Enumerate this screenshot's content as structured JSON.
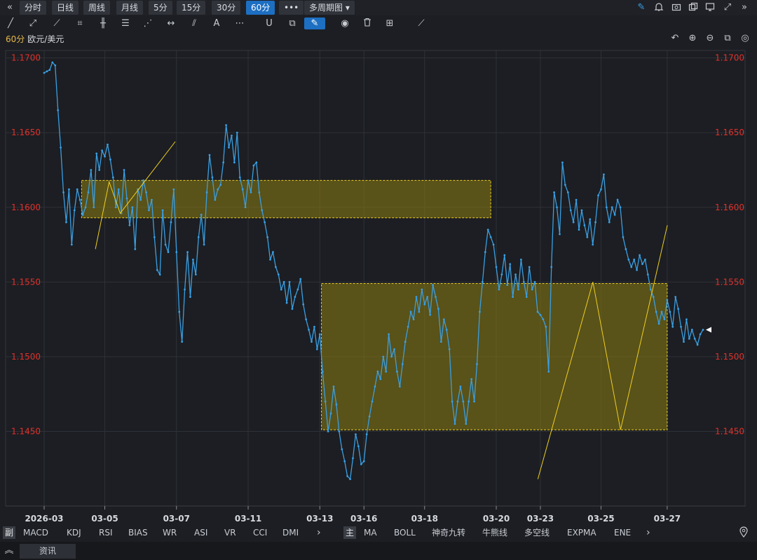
{
  "toolbar": {
    "periods": [
      "分时",
      "日线",
      "周线",
      "月线",
      "5分",
      "15分",
      "30分",
      "60分"
    ],
    "active_period": "60分",
    "more": "•••",
    "multi_period": "多周期图 ▾"
  },
  "chart_header": {
    "period": "60分",
    "symbol": "欧元/美元"
  },
  "indicator_tabs": {
    "sub_label": "副",
    "sub": [
      "MACD",
      "KDJ",
      "RSI",
      "BIAS",
      "WR",
      "ASI",
      "VR",
      "CCI",
      "DMI"
    ],
    "main_label": "主",
    "main": [
      "MA",
      "BOLL",
      "神奇九转",
      "牛熊线",
      "多空线",
      "EXPMA",
      "ENE"
    ],
    "arrow": "›"
  },
  "footer": {
    "news": "资讯"
  },
  "colors": {
    "price_line": "#3a9fe3",
    "axis_price": "#e0302a",
    "drawing": "#f0d020",
    "rect_fill": "#8c7d12"
  },
  "chart_data": {
    "type": "line",
    "symbol": "欧元/美元",
    "period": "60分",
    "ylim": [
      1.14,
      1.1705
    ],
    "yticks": [
      "1.1700",
      "1.1650",
      "1.1600",
      "1.1550",
      "1.1500",
      "1.1450"
    ],
    "xticks": [
      {
        "i": 0,
        "label": "2026-03"
      },
      {
        "i": 22,
        "label": "03-05"
      },
      {
        "i": 48,
        "label": "03-07"
      },
      {
        "i": 74,
        "label": "03-11"
      },
      {
        "i": 100,
        "label": "03-13"
      },
      {
        "i": 116,
        "label": "03-16"
      },
      {
        "i": 138,
        "label": "03-18"
      },
      {
        "i": 164,
        "label": "03-20"
      },
      {
        "i": 180,
        "label": "03-23"
      },
      {
        "i": 202,
        "label": "03-25"
      },
      {
        "i": 226,
        "label": "03-27"
      }
    ],
    "points": 240,
    "anchors": [
      [
        0,
        1.169
      ],
      [
        2,
        1.1692
      ],
      [
        3,
        1.1697
      ],
      [
        4,
        1.1695
      ],
      [
        5,
        1.1665
      ],
      [
        6,
        1.164
      ],
      [
        7,
        1.161
      ],
      [
        8,
        1.159
      ],
      [
        9,
        1.1612
      ],
      [
        10,
        1.1575
      ],
      [
        11,
        1.1598
      ],
      [
        12,
        1.1612
      ],
      [
        13,
        1.1605
      ],
      [
        14,
        1.1595
      ],
      [
        15,
        1.16
      ],
      [
        16,
        1.161
      ],
      [
        17,
        1.1625
      ],
      [
        18,
        1.16
      ],
      [
        19,
        1.1636
      ],
      [
        20,
        1.1625
      ],
      [
        21,
        1.1638
      ],
      [
        22,
        1.1634
      ],
      [
        23,
        1.1642
      ],
      [
        24,
        1.1632
      ],
      [
        25,
        1.162
      ],
      [
        26,
        1.16
      ],
      [
        27,
        1.1612
      ],
      [
        28,
        1.1596
      ],
      [
        29,
        1.1625
      ],
      [
        30,
        1.1606
      ],
      [
        31,
        1.1588
      ],
      [
        32,
        1.16
      ],
      [
        33,
        1.1572
      ],
      [
        34,
        1.1612
      ],
      [
        35,
        1.1605
      ],
      [
        36,
        1.1618
      ],
      [
        37,
        1.161
      ],
      [
        38,
        1.1598
      ],
      [
        39,
        1.1605
      ],
      [
        40,
        1.158
      ],
      [
        41,
        1.1558
      ],
      [
        42,
        1.1555
      ],
      [
        43,
        1.1598
      ],
      [
        44,
        1.1575
      ],
      [
        45,
        1.157
      ],
      [
        46,
        1.159
      ],
      [
        47,
        1.1612
      ],
      [
        48,
        1.157
      ],
      [
        49,
        1.153
      ],
      [
        50,
        1.151
      ],
      [
        51,
        1.1545
      ],
      [
        52,
        1.157
      ],
      [
        53,
        1.154
      ],
      [
        54,
        1.1565
      ],
      [
        55,
        1.1555
      ],
      [
        56,
        1.158
      ],
      [
        57,
        1.1595
      ],
      [
        58,
        1.1575
      ],
      [
        59,
        1.161
      ],
      [
        60,
        1.1635
      ],
      [
        61,
        1.162
      ],
      [
        62,
        1.1605
      ],
      [
        63,
        1.1612
      ],
      [
        64,
        1.1615
      ],
      [
        65,
        1.163
      ],
      [
        66,
        1.1655
      ],
      [
        67,
        1.164
      ],
      [
        68,
        1.1648
      ],
      [
        69,
        1.163
      ],
      [
        70,
        1.165
      ],
      [
        71,
        1.162
      ],
      [
        72,
        1.1612
      ],
      [
        73,
        1.16
      ],
      [
        74,
        1.1618
      ],
      [
        75,
        1.161
      ],
      [
        76,
        1.1628
      ],
      [
        77,
        1.163
      ],
      [
        78,
        1.161
      ],
      [
        79,
        1.1598
      ],
      [
        80,
        1.159
      ],
      [
        81,
        1.158
      ],
      [
        82,
        1.1565
      ],
      [
        83,
        1.157
      ],
      [
        84,
        1.156
      ],
      [
        85,
        1.1555
      ],
      [
        86,
        1.1545
      ],
      [
        87,
        1.155
      ],
      [
        88,
        1.1536
      ],
      [
        89,
        1.155
      ],
      [
        90,
        1.1532
      ],
      [
        91,
        1.154
      ],
      [
        92,
        1.1545
      ],
      [
        93,
        1.1552
      ],
      [
        94,
        1.1535
      ],
      [
        95,
        1.1525
      ],
      [
        96,
        1.1518
      ],
      [
        97,
        1.151
      ],
      [
        98,
        1.152
      ],
      [
        99,
        1.1505
      ],
      [
        100,
        1.1515
      ],
      [
        101,
        1.149
      ],
      [
        102,
        1.147
      ],
      [
        103,
        1.145
      ],
      [
        104,
        1.1462
      ],
      [
        105,
        1.148
      ],
      [
        106,
        1.1468
      ],
      [
        107,
        1.145
      ],
      [
        108,
        1.1438
      ],
      [
        109,
        1.143
      ],
      [
        110,
        1.142
      ],
      [
        111,
        1.1418
      ],
      [
        112,
        1.1432
      ],
      [
        113,
        1.1448
      ],
      [
        114,
        1.144
      ],
      [
        115,
        1.1428
      ],
      [
        116,
        1.143
      ],
      [
        117,
        1.1448
      ],
      [
        118,
        1.146
      ],
      [
        119,
        1.147
      ],
      [
        120,
        1.148
      ],
      [
        121,
        1.149
      ],
      [
        122,
        1.1485
      ],
      [
        123,
        1.15
      ],
      [
        124,
        1.149
      ],
      [
        125,
        1.1515
      ],
      [
        126,
        1.15
      ],
      [
        127,
        1.1505
      ],
      [
        128,
        1.149
      ],
      [
        129,
        1.148
      ],
      [
        130,
        1.1495
      ],
      [
        131,
        1.151
      ],
      [
        132,
        1.152
      ],
      [
        133,
        1.153
      ],
      [
        134,
        1.1525
      ],
      [
        135,
        1.154
      ],
      [
        136,
        1.153
      ],
      [
        137,
        1.1545
      ],
      [
        138,
        1.1535
      ],
      [
        139,
        1.154
      ],
      [
        140,
        1.1528
      ],
      [
        141,
        1.1548
      ],
      [
        142,
        1.154
      ],
      [
        143,
        1.1532
      ],
      [
        144,
        1.151
      ],
      [
        145,
        1.1525
      ],
      [
        146,
        1.1518
      ],
      [
        147,
        1.1505
      ],
      [
        148,
        1.147
      ],
      [
        149,
        1.1455
      ],
      [
        150,
        1.147
      ],
      [
        151,
        1.148
      ],
      [
        152,
        1.147
      ],
      [
        153,
        1.1455
      ],
      [
        154,
        1.147
      ],
      [
        155,
        1.1485
      ],
      [
        156,
        1.147
      ],
      [
        157,
        1.1495
      ],
      [
        158,
        1.153
      ],
      [
        159,
        1.155
      ],
      [
        160,
        1.157
      ],
      [
        161,
        1.1585
      ],
      [
        162,
        1.158
      ],
      [
        163,
        1.1575
      ],
      [
        164,
        1.156
      ],
      [
        165,
        1.1545
      ],
      [
        166,
        1.1555
      ],
      [
        167,
        1.1568
      ],
      [
        168,
        1.1548
      ],
      [
        169,
        1.1562
      ],
      [
        170,
        1.154
      ],
      [
        171,
        1.1555
      ],
      [
        172,
        1.1545
      ],
      [
        173,
        1.1565
      ],
      [
        174,
        1.155
      ],
      [
        175,
        1.154
      ],
      [
        176,
        1.156
      ],
      [
        177,
        1.1545
      ],
      [
        178,
        1.155
      ],
      [
        179,
        1.153
      ],
      [
        180,
        1.1528
      ],
      [
        181,
        1.1525
      ],
      [
        182,
        1.152
      ],
      [
        183,
        1.149
      ],
      [
        184,
        1.156
      ],
      [
        185,
        1.161
      ],
      [
        186,
        1.16
      ],
      [
        187,
        1.1582
      ],
      [
        188,
        1.163
      ],
      [
        189,
        1.1615
      ],
      [
        190,
        1.161
      ],
      [
        191,
        1.1598
      ],
      [
        192,
        1.159
      ],
      [
        193,
        1.1605
      ],
      [
        194,
        1.1585
      ],
      [
        195,
        1.1598
      ],
      [
        196,
        1.1588
      ],
      [
        197,
        1.158
      ],
      [
        198,
        1.1592
      ],
      [
        199,
        1.1575
      ],
      [
        200,
        1.159
      ],
      [
        201,
        1.1608
      ],
      [
        202,
        1.1612
      ],
      [
        203,
        1.1622
      ],
      [
        204,
        1.16
      ],
      [
        205,
        1.159
      ],
      [
        206,
        1.16
      ],
      [
        207,
        1.1595
      ],
      [
        208,
        1.1605
      ],
      [
        209,
        1.16
      ],
      [
        210,
        1.158
      ],
      [
        211,
        1.1572
      ],
      [
        212,
        1.1565
      ],
      [
        213,
        1.156
      ],
      [
        214,
        1.1565
      ],
      [
        215,
        1.1558
      ],
      [
        216,
        1.1568
      ],
      [
        217,
        1.1562
      ],
      [
        218,
        1.1565
      ],
      [
        219,
        1.1555
      ],
      [
        220,
        1.1545
      ],
      [
        221,
        1.154
      ],
      [
        222,
        1.153
      ],
      [
        223,
        1.1522
      ],
      [
        224,
        1.153
      ],
      [
        225,
        1.1525
      ],
      [
        226,
        1.1538
      ],
      [
        227,
        1.153
      ],
      [
        228,
        1.152
      ],
      [
        229,
        1.154
      ],
      [
        230,
        1.1532
      ],
      [
        231,
        1.152
      ],
      [
        232,
        1.151
      ],
      [
        233,
        1.1525
      ],
      [
        234,
        1.1512
      ],
      [
        235,
        1.1518
      ],
      [
        236,
        1.1512
      ],
      [
        237,
        1.1508
      ],
      [
        238,
        1.1515
      ],
      [
        239,
        1.1518
      ]
    ],
    "rectangles": [
      {
        "i0": 9,
        "i1": 162,
        "y0": 1.1593,
        "y1": 1.1618
      },
      {
        "i0": 96,
        "i1": 226,
        "y0": 1.1451,
        "y1": 1.1549
      }
    ],
    "trendlines": [
      [
        [
          14,
          1.1572
        ],
        [
          19,
          1.1617
        ],
        [
          23,
          1.1596
        ],
        [
          43,
          1.1644
        ]
      ],
      [
        [
          160,
          1.1418
        ],
        [
          180,
          1.155
        ],
        [
          190,
          1.1451
        ],
        [
          207,
          1.1588
        ]
      ]
    ]
  }
}
